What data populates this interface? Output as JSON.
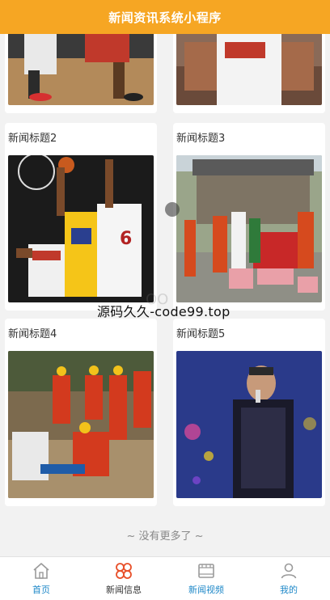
{
  "header": {
    "title": "新闻资讯系统小程序"
  },
  "cards": [
    {
      "title": "",
      "image": "basketball-game-photo"
    },
    {
      "title": "",
      "image": "basketball-player-photo"
    },
    {
      "title": "新闻标题2",
      "image": "basketball-dunk-photo"
    },
    {
      "title": "新闻标题3",
      "image": "village-gathering-photo"
    },
    {
      "title": "新闻标题4",
      "image": "rescue-workers-photo"
    },
    {
      "title": "新闻标题5",
      "image": "singer-concert-photo"
    }
  ],
  "list_footer": {
    "no_more_text": "~ 没有更多了 ~"
  },
  "watermark": {
    "text": "源码久久-code99.top",
    "ghost_text": "OO"
  },
  "tabbar": {
    "items": [
      {
        "label": "首页",
        "icon": "home-icon",
        "active": false
      },
      {
        "label": "新闻信息",
        "icon": "grid-flower-icon",
        "active": true
      },
      {
        "label": "新闻视频",
        "icon": "video-frame-icon",
        "active": false
      },
      {
        "label": "我的",
        "icon": "user-icon",
        "active": false
      }
    ]
  },
  "colors": {
    "header_bg": "#f6a623",
    "tab_active_icon": "#e8502a",
    "tab_inactive": "#1e88c8"
  }
}
